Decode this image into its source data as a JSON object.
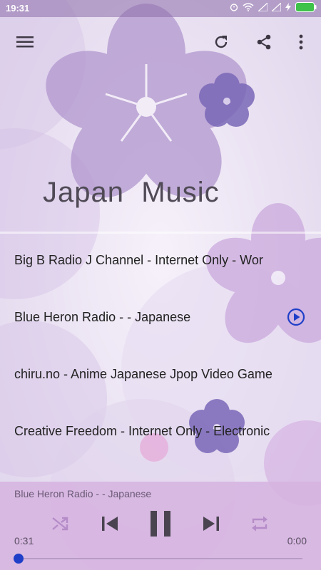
{
  "status_bar": {
    "time": "19:31",
    "icons": [
      "alarm-icon",
      "wifi-icon",
      "signal-icon",
      "signal-icon",
      "charging-icon",
      "battery-icon"
    ]
  },
  "toolbar": {
    "menu_icon": "menu-icon",
    "refresh_icon": "refresh-icon",
    "share_icon": "share-icon",
    "more_icon": "more-vert-icon"
  },
  "hero": {
    "title": "Japan  Music"
  },
  "stations": [
    {
      "name": "Big B Radio J Channel - Internet Only - Wor",
      "playing": false
    },
    {
      "name": "Blue Heron Radio - - Japanese",
      "playing": true
    },
    {
      "name": "chiru.no - Anime Japanese Jpop Video Game",
      "playing": false
    },
    {
      "name": "Creative Freedom - Internet Only - Electronic",
      "playing": false
    }
  ],
  "player": {
    "now_playing": "Blue Heron Radio - - Japanese",
    "elapsed": "0:31",
    "duration": "0:00",
    "progress": 0.0,
    "state": "playing"
  },
  "colors": {
    "accent": "#1f3fc8",
    "panel": "#d6b4e0",
    "petal": "#b49ad0",
    "petal_dark": "#7a68b8"
  }
}
